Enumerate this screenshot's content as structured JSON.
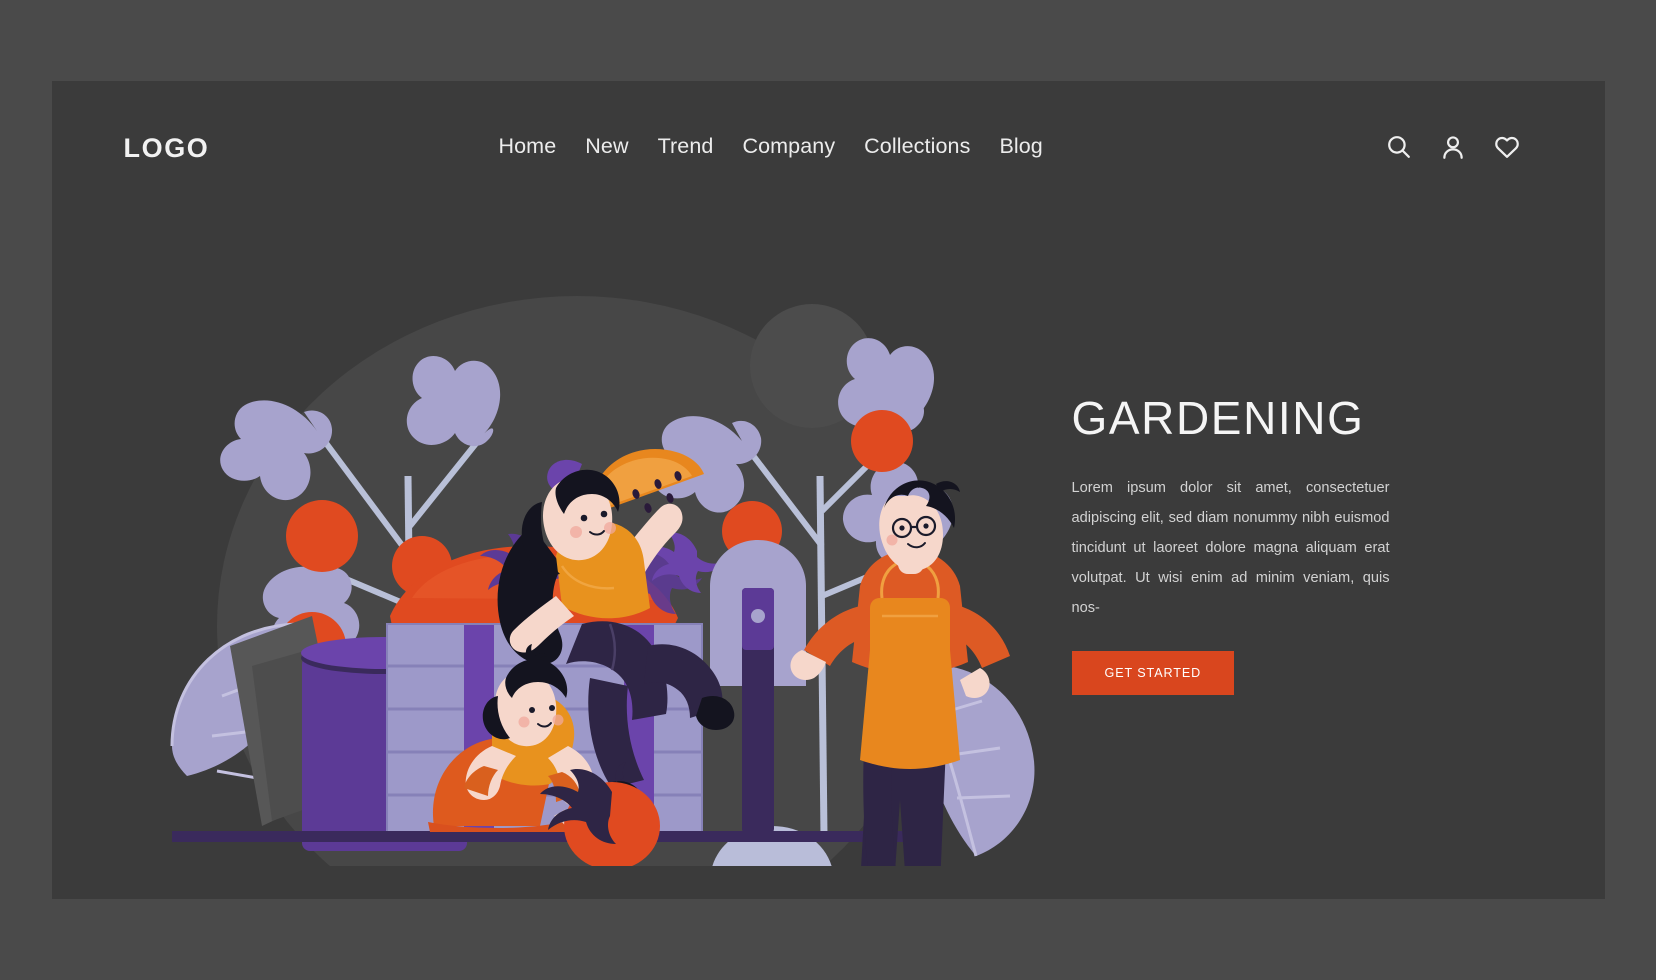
{
  "brand": {
    "logo": "LOGO"
  },
  "nav": {
    "items": [
      {
        "label": "Home"
      },
      {
        "label": "New"
      },
      {
        "label": "Trend"
      },
      {
        "label": "Company"
      },
      {
        "label": "Collections"
      },
      {
        "label": "Blog"
      }
    ]
  },
  "header_icons": [
    {
      "name": "search-icon"
    },
    {
      "name": "user-icon"
    },
    {
      "name": "heart-icon"
    }
  ],
  "hero": {
    "title": "GARDENING",
    "paragraph": "Lorem ipsum dolor sit amet, consectetuer adipiscing elit, sed diam nonummy nibh euismod tincidunt ut laoreet dolore magna aliquam erat volutpat. Ut wisi enim ad minim veniam, quis nos-",
    "cta_label": "GET STARTED"
  },
  "colors": {
    "page_background": "#3b3b3b",
    "outer_background": "#4a4a4a",
    "accent": "#d9461e",
    "tomato": "#e04a20",
    "lavender": "#a7a3cd",
    "purple": "#5c3a96",
    "light_purple": "#8e86c4",
    "orange": "#e8871e",
    "orange_dark": "#d9601e",
    "text_light": "#f2f2f2",
    "text_muted": "#d2d2d2",
    "skin": "#f6d7cb",
    "hair": "#1a1a2a",
    "ground": "#3a2a5c"
  },
  "illustration": {
    "name": "gardening-people-illustration",
    "alt": "Two women and a man harvesting giant tomatoes beside a wooden crate with plants"
  }
}
